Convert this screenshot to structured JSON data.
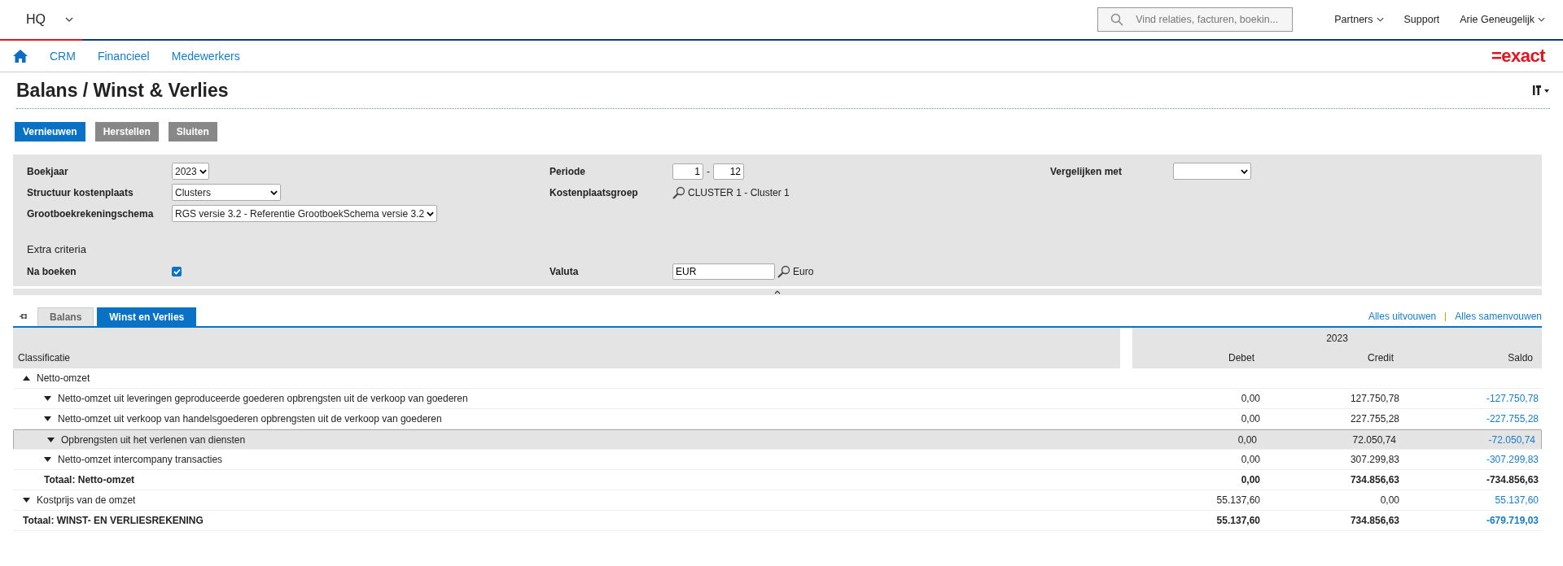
{
  "top_bar": {
    "company": "HQ",
    "search": {
      "placeholder": "Vind relaties, facturen, boekin..."
    },
    "menus": [
      {
        "label": "Partners",
        "dropdown": true
      },
      {
        "label": "Support",
        "dropdown": false
      },
      {
        "label": "Arie Geneugelijk",
        "dropdown": true
      }
    ]
  },
  "nav": {
    "items": [
      {
        "label": "CRM"
      },
      {
        "label": "Financieel"
      },
      {
        "label": "Medewerkers"
      }
    ],
    "logo": "=exact"
  },
  "page": {
    "title": "Balans / Winst & Verlies"
  },
  "actions": [
    {
      "label": "Vernieuwen",
      "kind": "primary"
    },
    {
      "label": "Herstellen",
      "kind": "secondary"
    },
    {
      "label": "Sluiten",
      "kind": "secondary"
    }
  ],
  "filters": {
    "boekjaar": {
      "label": "Boekjaar",
      "value": "2023"
    },
    "structuur": {
      "label": "Structuur kostenplaats",
      "value": "Clusters"
    },
    "schema": {
      "label": "Grootboekrekeningschema",
      "value": "RGS versie 3.2 - Referentie GrootboekSchema versie 3.2"
    },
    "periode": {
      "label": "Periode",
      "from": "1",
      "separator": "-",
      "to": "12"
    },
    "kostenplaatsgroep": {
      "label": "Kostenplaatsgroep",
      "value": "CLUSTER 1 - Cluster 1"
    },
    "vergelijken": {
      "label": "Vergelijken met"
    },
    "extra_title": "Extra criteria",
    "na_boeken": {
      "label": "Na boeken",
      "checked": true
    },
    "valuta": {
      "label": "Valuta",
      "value": "EUR",
      "description": "Euro"
    }
  },
  "tabs": [
    {
      "label": "Balans",
      "selected": false
    },
    {
      "label": "Winst en Verlies",
      "selected": true
    }
  ],
  "links": [
    "Alles uitvouwen",
    "Alles samenvouwen"
  ],
  "table": {
    "columns": [
      "Classificatie",
      "Debet",
      "Credit",
      "Saldo"
    ],
    "year": "2023",
    "rows": [
      {
        "kind": "group",
        "label": "Netto-omzet",
        "expanded": true,
        "selected": false,
        "children": [
          {
            "kind": "group",
            "label": "Netto-omzet uit leveringen geproduceerde goederen opbrengsten uit de verkoop van goederen",
            "expanded": false,
            "selected": false,
            "debet": "0,00",
            "credit": "127.750,78",
            "saldo": "-127.750,78",
            "saldo_link": true
          },
          {
            "kind": "group",
            "label": "Netto-omzet uit verkoop van handelsgoederen opbrengsten uit de verkoop van goederen",
            "expanded": false,
            "selected": false,
            "debet": "0,00",
            "credit": "227.755,28",
            "saldo": "-227.755,28",
            "saldo_link": true
          },
          {
            "kind": "group",
            "label": "Opbrengsten uit het verlenen van diensten",
            "expanded": false,
            "selected": true,
            "debet": "0,00",
            "credit": "72.050,74",
            "saldo": "-72.050,74",
            "saldo_link": true
          },
          {
            "kind": "group",
            "label": "Netto-omzet intercompany transacties",
            "expanded": false,
            "selected": false,
            "debet": "0,00",
            "credit": "307.299,83",
            "saldo": "-307.299,83",
            "saldo_link": true
          },
          {
            "kind": "total",
            "label": "Totaal: Netto-omzet",
            "selected": false,
            "debet": "0,00",
            "credit": "734.856,63",
            "saldo": "-734.856,63",
            "saldo_link": false
          }
        ]
      },
      {
        "kind": "group",
        "label": "Kostprijs van de omzet",
        "expanded": false,
        "selected": false,
        "debet": "55.137,60",
        "credit": "0,00",
        "saldo": "55.137,60",
        "saldo_link": true
      },
      {
        "kind": "total",
        "label": "Totaal: WINST- EN VERLIESREKENING",
        "selected": false,
        "debet": "55.137,60",
        "credit": "734.856,63",
        "saldo": "-679.719,03",
        "saldo_link": true
      }
    ]
  }
}
